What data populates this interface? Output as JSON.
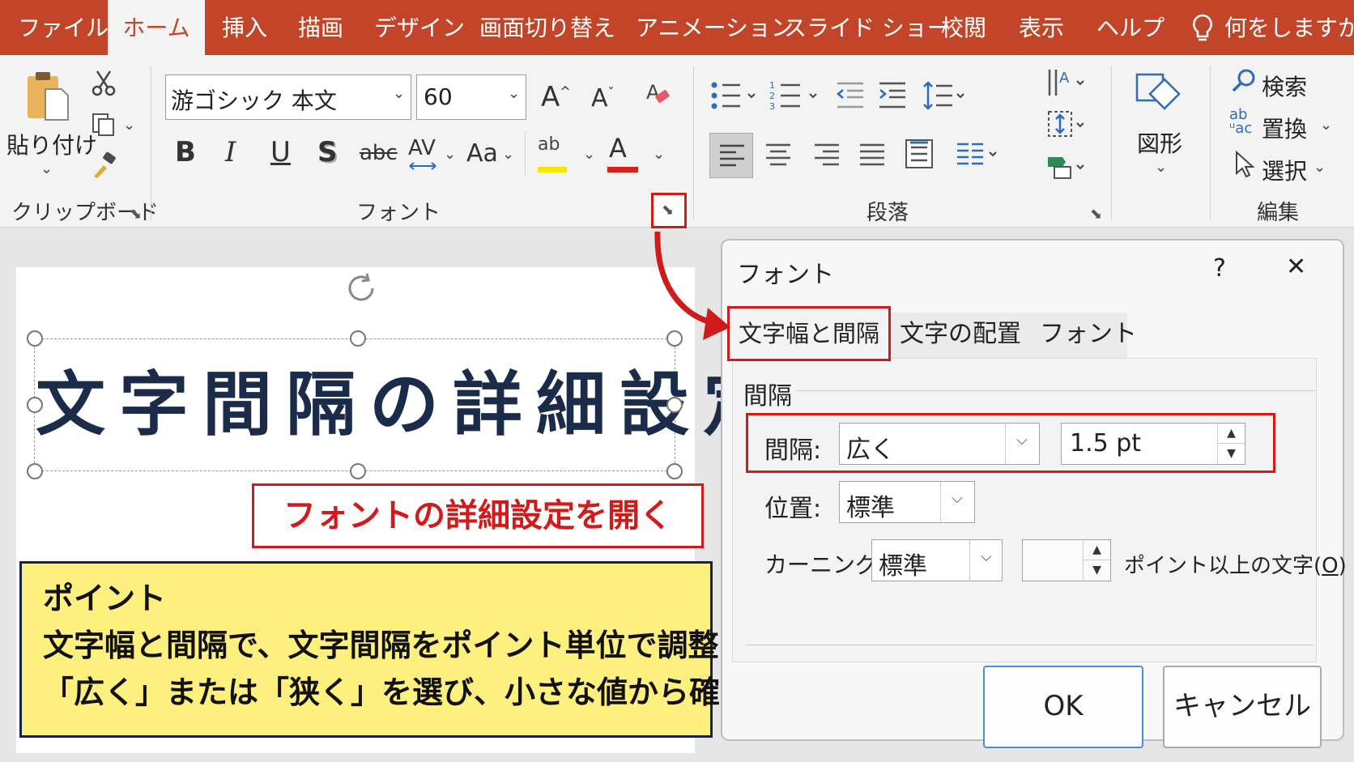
{
  "ribbon": {
    "tabs": [
      {
        "label": "ファイル",
        "active": false
      },
      {
        "label": "ホーム",
        "active": true
      },
      {
        "label": "挿入",
        "active": false
      },
      {
        "label": "描画",
        "active": false
      },
      {
        "label": "デザイン",
        "active": false
      },
      {
        "label": "画面切り替え",
        "active": false
      },
      {
        "label": "アニメーション",
        "active": false
      },
      {
        "label": "スライド ショー",
        "active": false
      },
      {
        "label": "校閲",
        "active": false
      },
      {
        "label": "表示",
        "active": false
      },
      {
        "label": "ヘルプ",
        "active": false
      }
    ],
    "tell_me": "何をしますか",
    "clipboard": {
      "paste_label": "貼り付け",
      "group_label": "クリップボード"
    },
    "font": {
      "font_name": "游ゴシック 本文",
      "font_size": "60",
      "bold": "B",
      "italic": "I",
      "underline": "U",
      "shadow": "S",
      "strike": "abc",
      "spacing": "AV",
      "case": "Aa",
      "highlight": "ab",
      "color_letter": "A",
      "grow": "A",
      "shrink": "A",
      "group_label": "フォント"
    },
    "paragraph": {
      "group_label": "段落"
    },
    "drawing": {
      "shapes_label": "図形"
    },
    "editing": {
      "find": "検索",
      "replace": "置換",
      "select": "選択",
      "replace_icon_text": "ab",
      "group_label": "編集"
    },
    "accent_color": "#c2452a"
  },
  "slide": {
    "title": "文字間隔の詳細設定",
    "callout": "フォントの詳細設定を開く",
    "point": {
      "heading": "ポイント",
      "line1": "文字幅と間隔で、文字間隔をポイント単位で調整",
      "line2": "「広く」または「狭く」を選び、小さな値から確認"
    }
  },
  "dialog": {
    "title": "フォント",
    "help": "?",
    "close": "✕",
    "tabs": [
      "文字幅と間隔",
      "文字の配置",
      "フォント"
    ],
    "section": "間隔",
    "spacing_label": "間隔:",
    "spacing_value": "広く",
    "spacing_amount": "1.5 pt",
    "position_label": "位置:",
    "position_value": "標準",
    "kerning_label": "カーニング:",
    "kerning_value": "標準",
    "kerning_pt": "",
    "kerning_suffix": "ポイント以上の文字(",
    "kerning_key": "O",
    "kerning_close": ")",
    "ok": "OK",
    "cancel": "キャンセル"
  }
}
